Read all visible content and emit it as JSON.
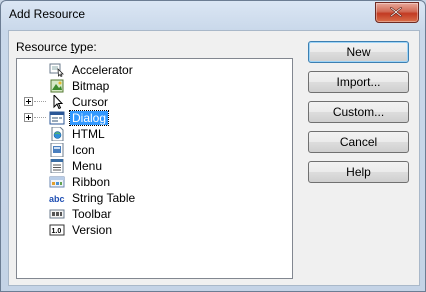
{
  "window": {
    "title": "Add Resource"
  },
  "resource_type_label": {
    "prefix": "Resource ",
    "accel": "t",
    "suffix": "ype:"
  },
  "tree": [
    {
      "label": "Accelerator",
      "icon": "accelerator-icon",
      "expandable": false,
      "selected": false
    },
    {
      "label": "Bitmap",
      "icon": "bitmap-icon",
      "expandable": false,
      "selected": false
    },
    {
      "label": "Cursor",
      "icon": "cursor-icon",
      "expandable": true,
      "selected": false
    },
    {
      "label": "Dialog",
      "icon": "dialog-icon",
      "expandable": true,
      "selected": true
    },
    {
      "label": "HTML",
      "icon": "html-icon",
      "expandable": false,
      "selected": false
    },
    {
      "label": "Icon",
      "icon": "icon-resource-icon",
      "expandable": false,
      "selected": false
    },
    {
      "label": "Menu",
      "icon": "menu-icon",
      "expandable": false,
      "selected": false
    },
    {
      "label": "Ribbon",
      "icon": "ribbon-icon",
      "expandable": false,
      "selected": false
    },
    {
      "label": "String Table",
      "icon": "string-table-icon",
      "expandable": false,
      "selected": false
    },
    {
      "label": "Toolbar",
      "icon": "toolbar-icon",
      "expandable": false,
      "selected": false
    },
    {
      "label": "Version",
      "icon": "version-icon",
      "expandable": false,
      "selected": false
    }
  ],
  "buttons": {
    "new": {
      "accel": "N",
      "rest": "ew"
    },
    "import": {
      "pre": "",
      "accel": "I",
      "rest": "mport..."
    },
    "custom": {
      "accel": "C",
      "rest": "ustom..."
    },
    "cancel": {
      "pre": "",
      "accel": "C",
      "rest": "ancel"
    },
    "help": {
      "accel": "H",
      "rest": "elp"
    }
  },
  "icon_text": {
    "abc": "abc",
    "version": "1.0"
  }
}
